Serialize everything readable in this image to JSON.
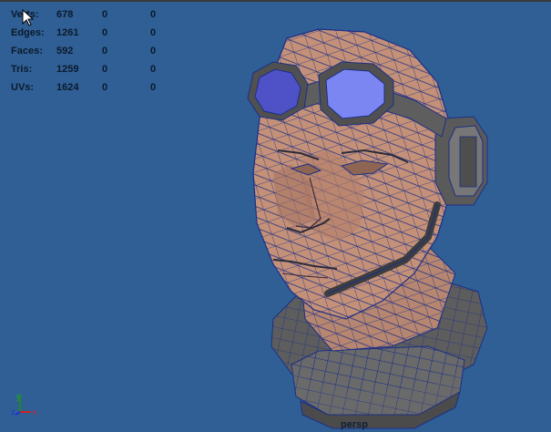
{
  "hud": {
    "stats": [
      {
        "label": "Verts:",
        "v1": "678",
        "v2": "0",
        "v3": "0"
      },
      {
        "label": "Edges:",
        "v1": "1261",
        "v2": "0",
        "v3": "0"
      },
      {
        "label": "Faces:",
        "v1": "592",
        "v2": "0",
        "v3": "0"
      },
      {
        "label": "Tris:",
        "v1": "1259",
        "v2": "0",
        "v3": "0"
      },
      {
        "label": "UVs:",
        "v1": "1624",
        "v2": "0",
        "v3": "0"
      }
    ]
  },
  "camera": {
    "name": "persp"
  },
  "axis": {
    "x": "x",
    "y": "y",
    "z": "z"
  },
  "colors": {
    "viewport_bg": "#2f5f95",
    "skin": "#c49178",
    "wire": "#1d2f86",
    "metal": "#5f5f5f",
    "lens": "#7b86f2"
  }
}
